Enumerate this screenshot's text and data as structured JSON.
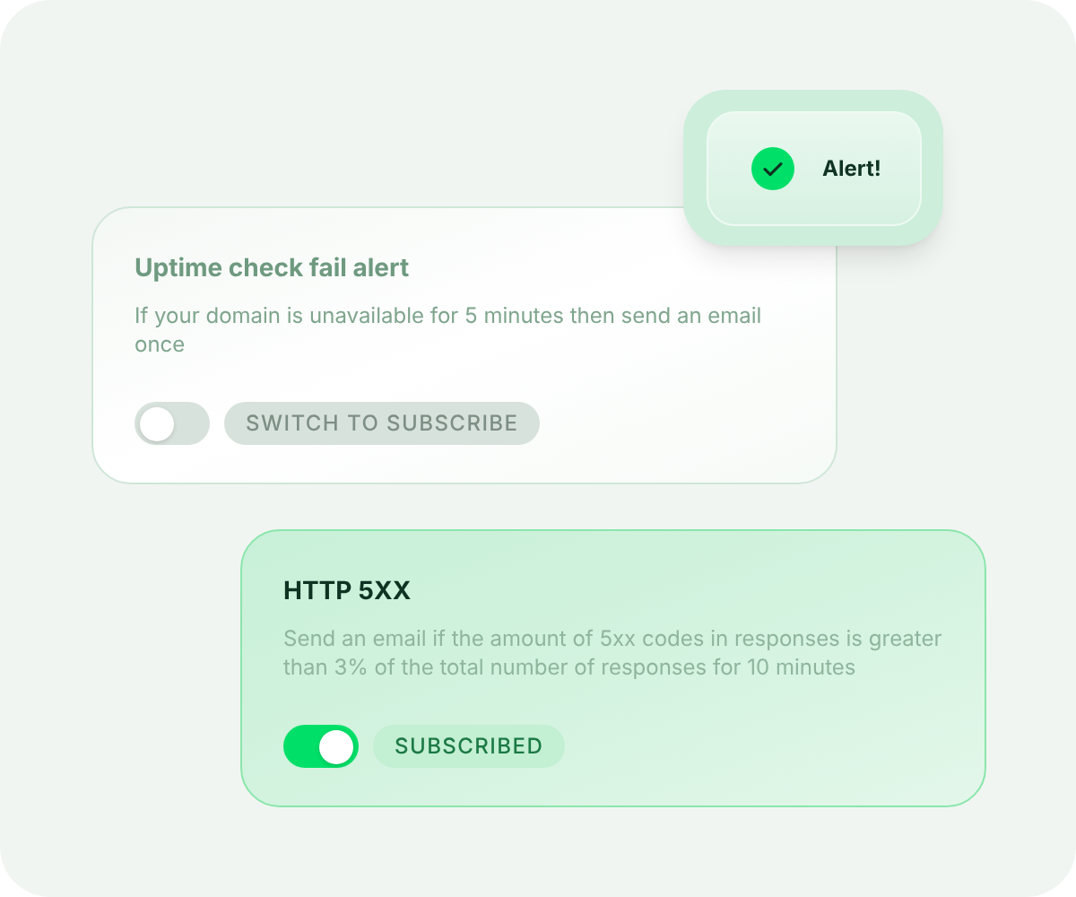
{
  "alert": {
    "label": "Alert!"
  },
  "cards": [
    {
      "title": "Uptime check fail alert",
      "description": "If your domain is unavailable for 5 minutes then send an email once",
      "on": false,
      "status": "SWITCH TO SUBSCRIBE"
    },
    {
      "title": "HTTP 5XX",
      "description": "Send an email if the amount of 5xx codes in responses is greater than 3% of the total number of responses for 10 minutes",
      "on": true,
      "status": "SUBSCRIBED"
    }
  ]
}
